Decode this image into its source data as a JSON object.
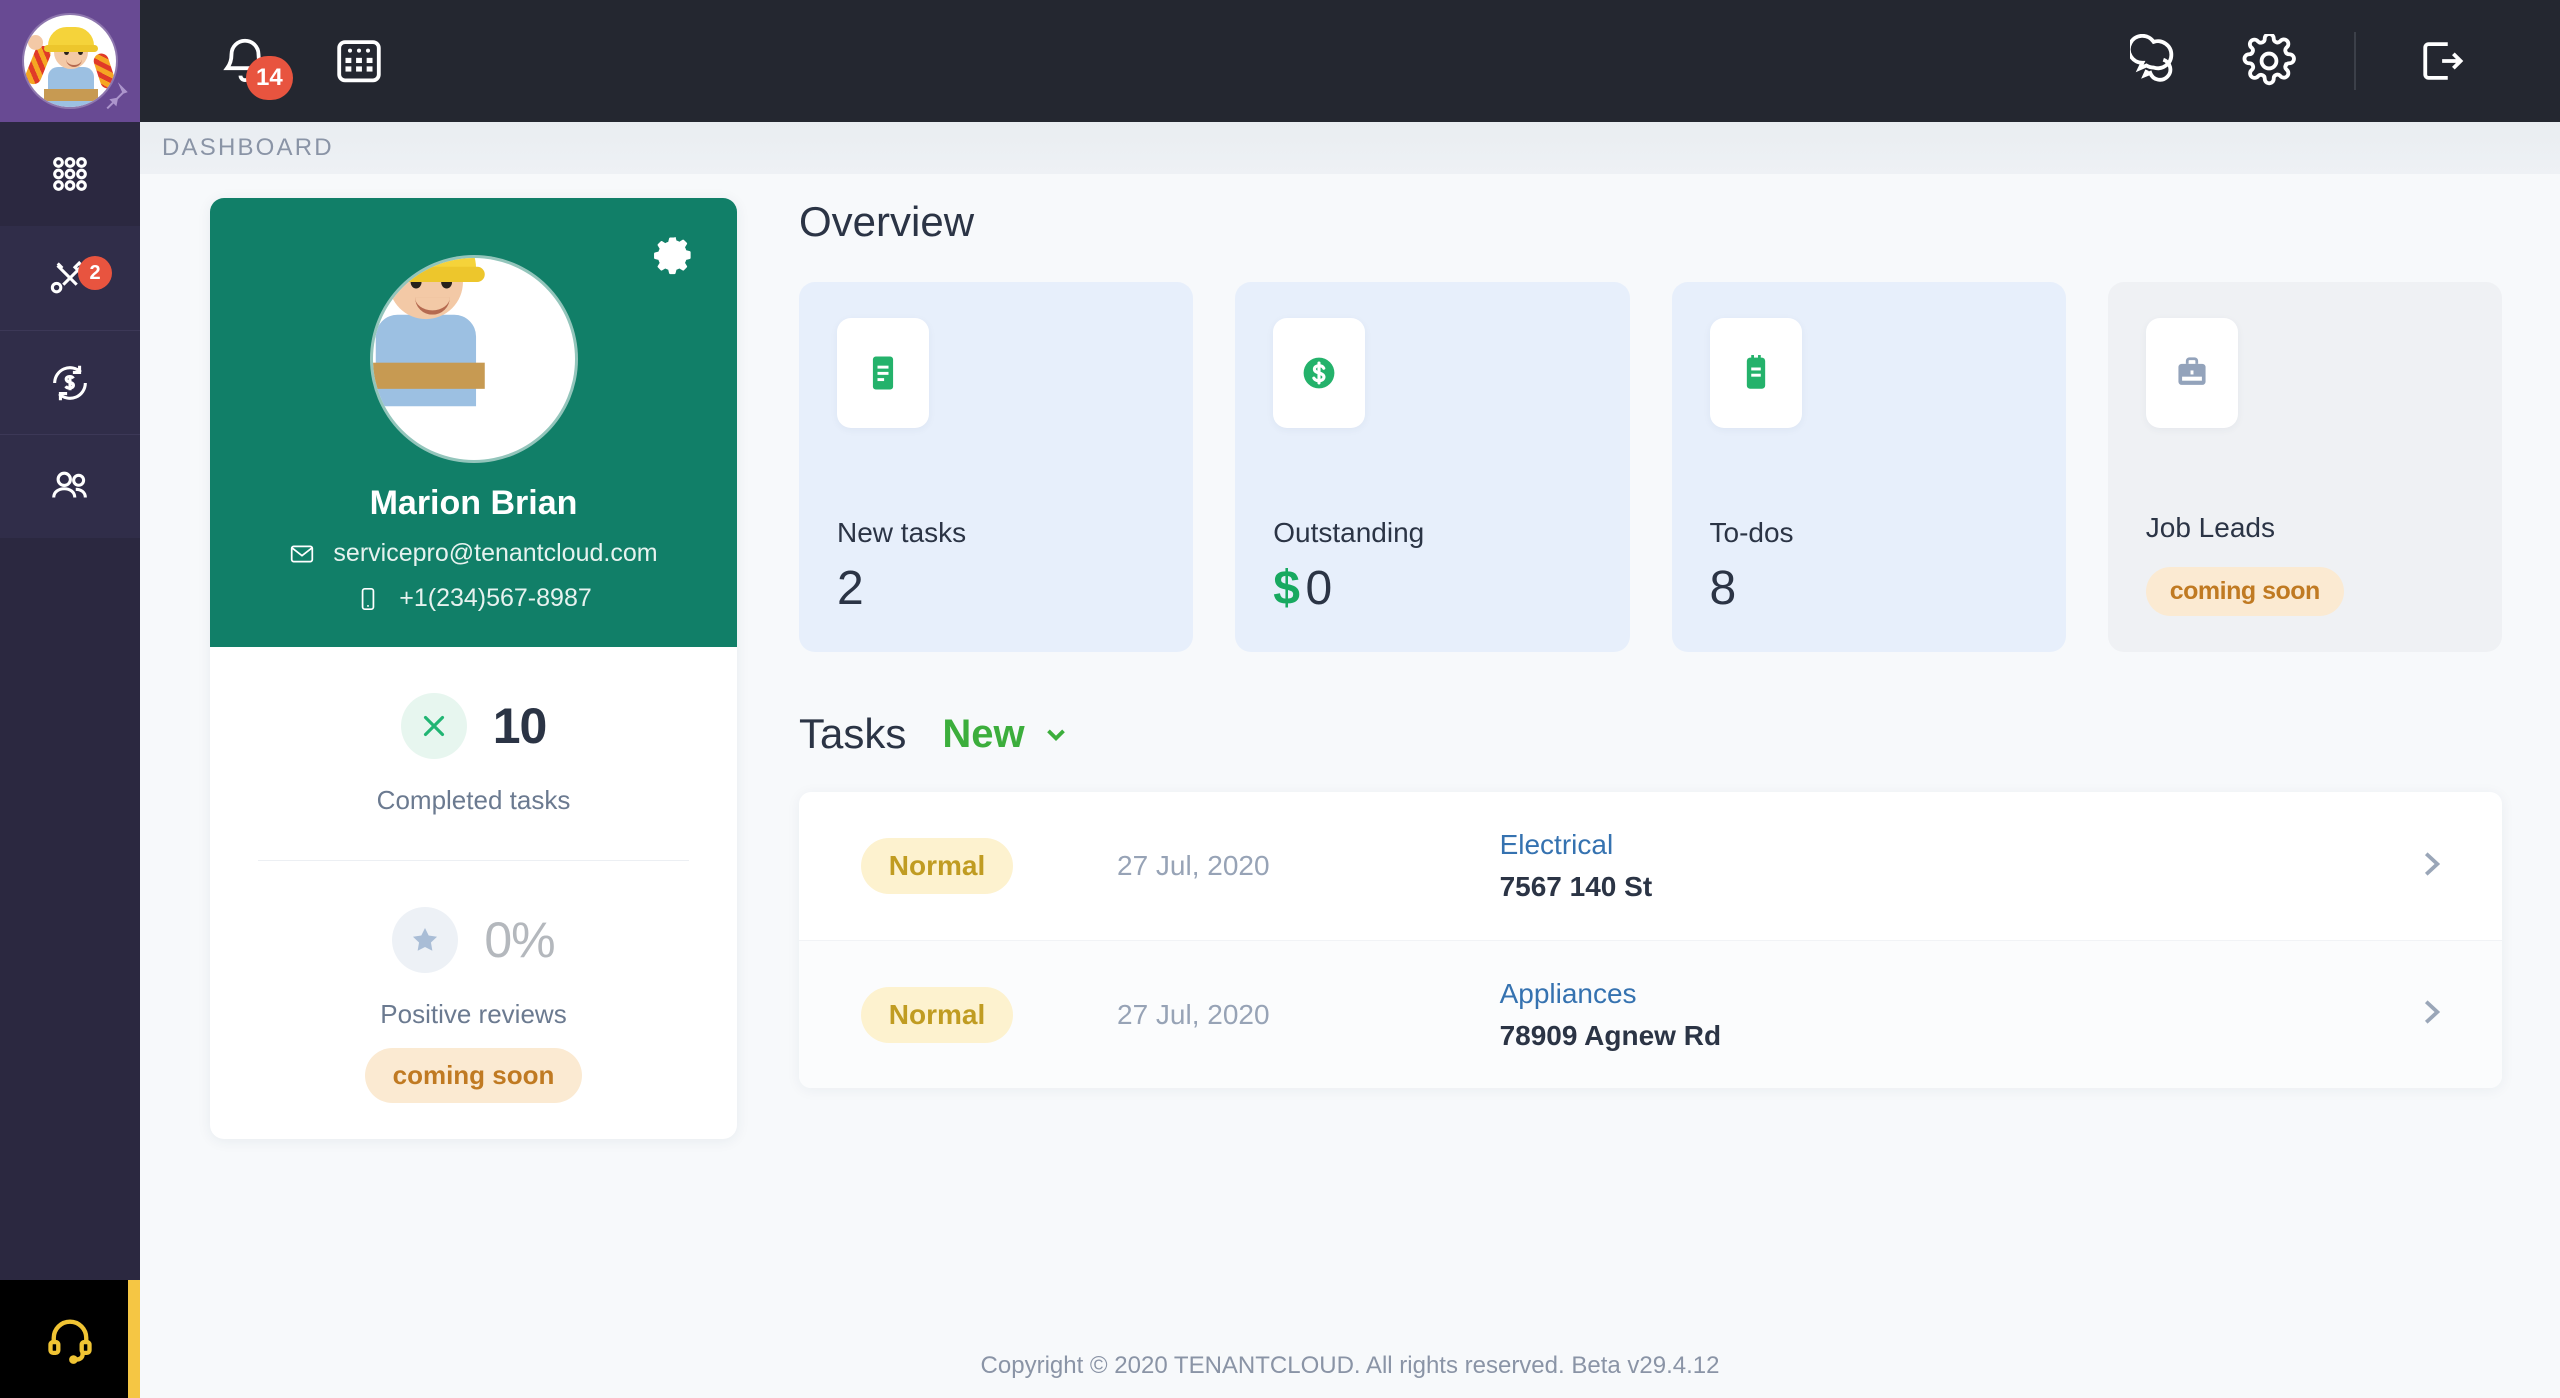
{
  "rail": {
    "avatar_name": "avatar-marion-brian",
    "pin_icon": "pin-icon",
    "items": [
      {
        "icon": "grid-apps-icon",
        "name": "sidebar-item-apps",
        "badge": ""
      },
      {
        "icon": "tools-icon",
        "name": "sidebar-item-tasks",
        "badge": "2"
      },
      {
        "icon": "money-refresh-icon",
        "name": "sidebar-item-payments",
        "badge": ""
      },
      {
        "icon": "people-icon",
        "name": "sidebar-item-contacts",
        "badge": ""
      }
    ],
    "support_icon": "headset-support-icon"
  },
  "topbar": {
    "notifications": {
      "icon": "bell-icon",
      "badge": "14"
    },
    "calendar": {
      "icon": "calendar-icon"
    },
    "chat": {
      "icon": "chat-bubbles-icon"
    },
    "settings": {
      "icon": "gear-icon"
    },
    "logout": {
      "icon": "logout-icon"
    }
  },
  "breadcrumb": {
    "label": "DASHBOARD"
  },
  "profile": {
    "gear_icon": "gear-icon",
    "name": "Marion Brian",
    "email": "servicepro@tenantcloud.com",
    "email_icon": "envelope-icon",
    "phone": "+1(234)567-8987",
    "phone_icon": "mobile-icon",
    "stats": [
      {
        "icon": "tools-icon",
        "value": "10",
        "label": "Completed tasks",
        "badge": ""
      },
      {
        "icon": "star-icon",
        "value": "0%",
        "label": "Positive reviews",
        "badge": "coming soon"
      }
    ]
  },
  "overview": {
    "title": "Overview",
    "cards": [
      {
        "icon": "document-lines-icon",
        "label": "New tasks",
        "value": "2",
        "currency": "",
        "badge": "",
        "theme": "blue"
      },
      {
        "icon": "dollar-circle-icon",
        "label": "Outstanding",
        "value": "0",
        "currency": "$",
        "badge": "",
        "theme": "blue"
      },
      {
        "icon": "clipboard-icon",
        "label": "To-dos",
        "value": "8",
        "currency": "",
        "badge": "",
        "theme": "blue"
      },
      {
        "icon": "briefcase-icon",
        "label": "Job Leads",
        "value": "",
        "currency": "",
        "badge": "coming soon",
        "theme": "grey"
      }
    ]
  },
  "tasks": {
    "title": "Tasks",
    "filter_label": "New",
    "filter_icon": "chevron-down-icon",
    "rows": [
      {
        "priority": "Normal",
        "date": "27 Jul, 2020",
        "category": "Electrical",
        "address": "7567 140 St",
        "arrow_icon": "chevron-right-icon"
      },
      {
        "priority": "Normal",
        "date": "27 Jul, 2020",
        "category": "Appliances",
        "address": "78909 Agnew Rd",
        "arrow_icon": "chevron-right-icon"
      }
    ]
  },
  "footer": {
    "text": "Copyright © 2020 TENANTCLOUD. All rights reserved. Beta v29.4.12"
  },
  "colors": {
    "brand_green": "#117f68",
    "accent_green": "#3cae3c",
    "rail_purple": "#684a93",
    "rail_dark": "#2b2840",
    "topbar_dark": "#242730",
    "badge_red": "#e8543f",
    "soon_bg": "#fbead2",
    "soon_fg": "#c07a22",
    "priority_bg": "#fdf2cf",
    "priority_fg": "#c09c22",
    "link_blue": "#3572b0",
    "accent_yellow": "#f5c644"
  }
}
